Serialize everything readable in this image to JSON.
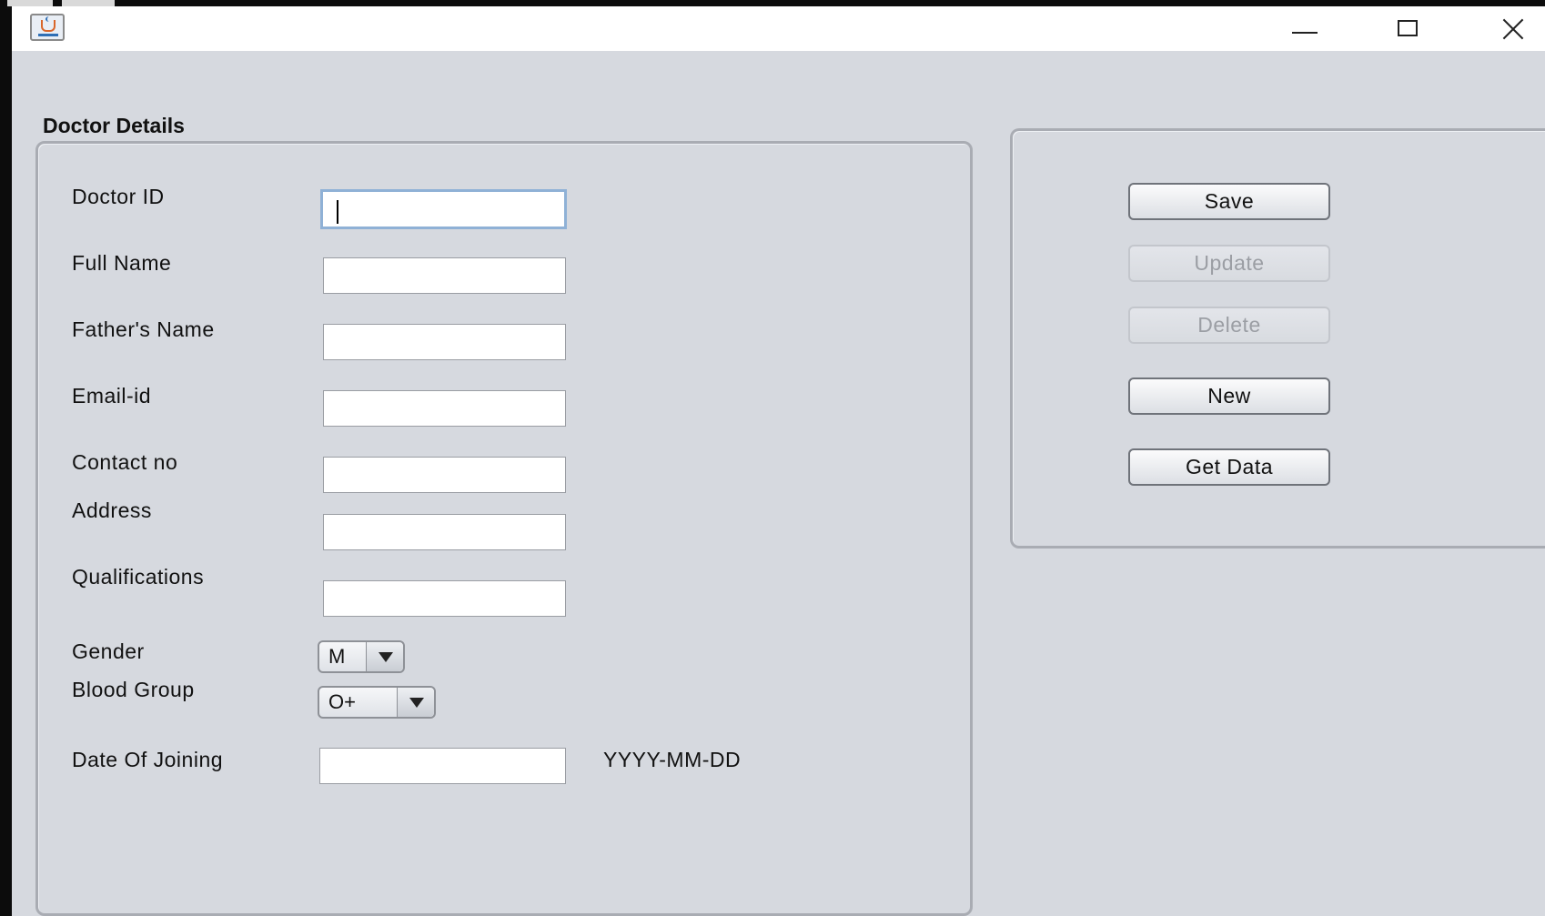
{
  "window": {
    "controls": [
      "minimize",
      "maximize",
      "close"
    ]
  },
  "form": {
    "section_title": "Doctor Details",
    "fields": [
      {
        "label": "Doctor ID",
        "value": ""
      },
      {
        "label": "Full Name",
        "value": ""
      },
      {
        "label": "Father's Name",
        "value": ""
      },
      {
        "label": "Email-id",
        "value": ""
      },
      {
        "label": "Contact no",
        "value": ""
      },
      {
        "label": "Address",
        "value": ""
      },
      {
        "label": "Qualifications",
        "value": ""
      }
    ],
    "gender": {
      "label": "Gender",
      "selected": "M"
    },
    "blood_group": {
      "label": "Blood Group",
      "selected": "O+"
    },
    "date_of_joining": {
      "label": "Date Of Joining",
      "value": "",
      "format_hint": "YYYY-MM-DD"
    }
  },
  "actions": {
    "save": {
      "label": "Save",
      "enabled": true
    },
    "update": {
      "label": "Update",
      "enabled": false
    },
    "delete": {
      "label": "Delete",
      "enabled": false
    },
    "new": {
      "label": "New",
      "enabled": true
    },
    "get_data": {
      "label": "Get Data",
      "enabled": true
    }
  },
  "icons": {
    "app_icon": "java-coffee-cup-icon"
  }
}
